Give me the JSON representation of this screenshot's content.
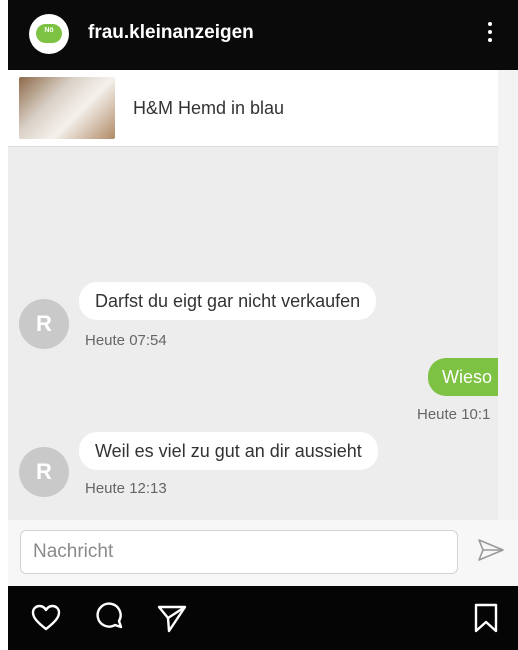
{
  "header": {
    "account_name": "frau.kleinanzeigen",
    "avatar_text": "Nö",
    "avatar_color": "#7dc242",
    "menu_icon": "more-vertical-icon"
  },
  "listing": {
    "title": "H&M Hemd in blau"
  },
  "messages": [
    {
      "direction": "incoming",
      "avatar_letter": "R",
      "text": "Darfst du eigt gar nicht verkaufen",
      "time": "Heute 07:54"
    },
    {
      "direction": "outgoing",
      "text": "Wieso",
      "time": "Heute 10:1"
    },
    {
      "direction": "incoming",
      "avatar_letter": "R",
      "text": "Weil es viel zu gut an dir aussieht",
      "time": "Heute 12:13"
    }
  ],
  "composer": {
    "placeholder": "Nachricht",
    "send_icon": "send-icon"
  },
  "bottom_bar": {
    "icons": [
      "heart-icon",
      "comment-icon",
      "share-icon",
      "bookmark-icon"
    ]
  },
  "colors": {
    "accent": "#7dc242",
    "bar": "#0a0a0a",
    "chat_bg": "#ededed"
  }
}
